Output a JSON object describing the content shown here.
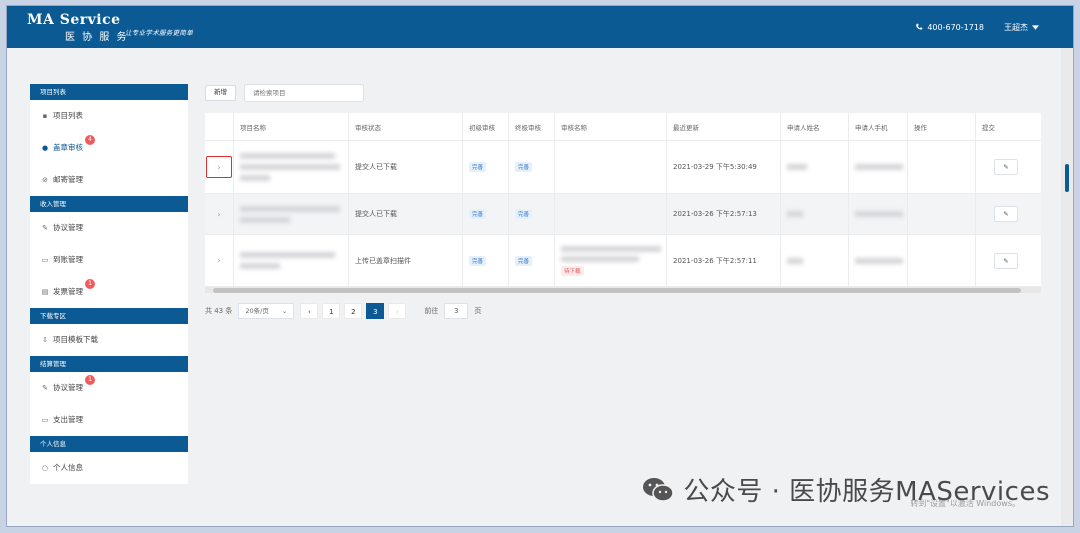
{
  "header": {
    "brand_title": "MA Service",
    "brand_subtitle": "医 协 服 务",
    "brand_tagline": "让专业学术服务更简单",
    "phone": "400-670-1718",
    "user": "王超杰"
  },
  "sidebar": {
    "sections": [
      {
        "title": "项目列表",
        "items": [
          {
            "label": "项目列表",
            "icon": "grid-icon",
            "badge": ""
          },
          {
            "label": "盖章审核",
            "icon": "person-icon",
            "badge": "4",
            "active": true
          },
          {
            "label": "邮寄管理",
            "icon": "send-icon",
            "badge": ""
          }
        ]
      },
      {
        "title": "收入管理",
        "items": [
          {
            "label": "协议管理",
            "icon": "edit-icon",
            "badge": ""
          },
          {
            "label": "到账管理",
            "icon": "inbox-icon",
            "badge": ""
          },
          {
            "label": "发票管理",
            "icon": "invoice-icon",
            "badge": "1"
          }
        ]
      },
      {
        "title": "下载专区",
        "items": [
          {
            "label": "项目模板下载",
            "icon": "download-icon",
            "badge": ""
          }
        ]
      },
      {
        "title": "结算管理",
        "items": [
          {
            "label": "协议管理",
            "icon": "edit-icon",
            "badge": "1"
          },
          {
            "label": "支出管理",
            "icon": "folder-icon",
            "badge": ""
          }
        ]
      },
      {
        "title": "个人信息",
        "items": [
          {
            "label": "个人信息",
            "icon": "user-icon",
            "badge": ""
          }
        ]
      }
    ]
  },
  "toolbar": {
    "new_label": "新增",
    "search_placeholder": "请检索项目"
  },
  "table": {
    "columns": [
      "项目名称",
      "审核状态",
      "初级审核",
      "终极审核",
      "审核名称",
      "最近更新",
      "申请人姓名",
      "申请人手机",
      "操作",
      "提交"
    ],
    "rows": [
      {
        "status": "提交人已下载",
        "first_review": "完善",
        "final_review": "完善",
        "review_tag": "",
        "updated": "2021-03-29 下午5:30:49"
      },
      {
        "status": "提交人已下载",
        "first_review": "完善",
        "final_review": "完善",
        "review_tag": "",
        "updated": "2021-03-26 下午2:57:13"
      },
      {
        "status": "上传已盖章扫描件",
        "first_review": "完善",
        "final_review": "完善",
        "review_tag": "待下载",
        "updated": "2021-03-26 下午2:57:11"
      }
    ]
  },
  "pager": {
    "total": "共 43 条",
    "page_size": "20条/页",
    "pages": [
      "1",
      "2",
      "3"
    ],
    "current_page": "3",
    "goto_label": "前往",
    "goto_value": "3",
    "page_suffix": "页"
  },
  "watermark": {
    "text": "公众号 · 医协服务MAServices",
    "activate": "转到\"设置\"以激活 Windows。"
  },
  "colors": {
    "primary": "#0c5a94",
    "badge": "#f25b5b",
    "highlight": "#e02e2e"
  }
}
